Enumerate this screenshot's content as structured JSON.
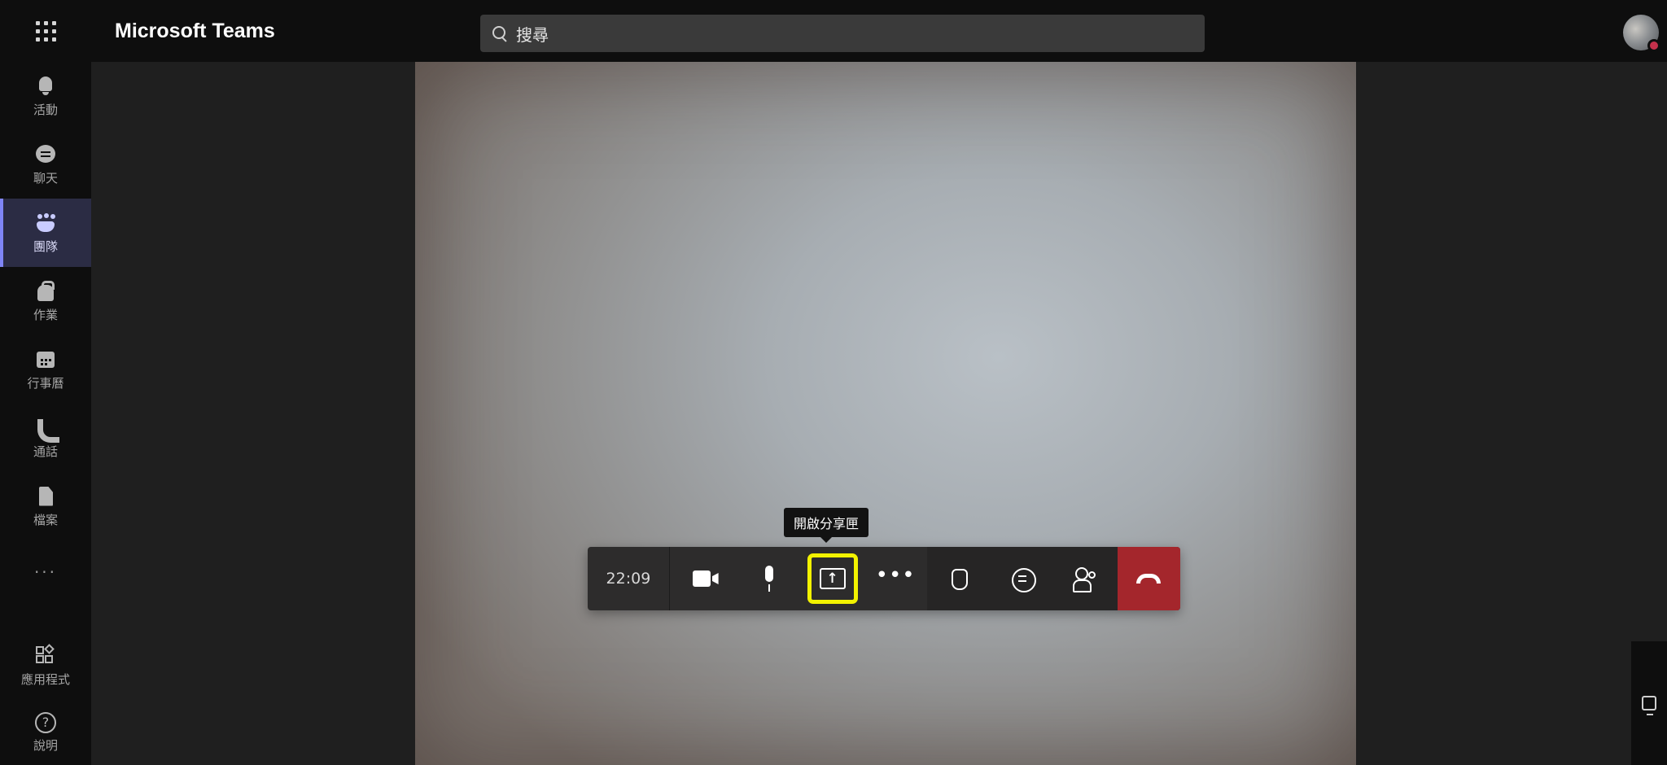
{
  "app": {
    "title": "Microsoft Teams"
  },
  "search": {
    "placeholder": "搜尋"
  },
  "sidebar": {
    "items": [
      {
        "label": "活動",
        "icon": "bell-icon"
      },
      {
        "label": "聊天",
        "icon": "chat-icon"
      },
      {
        "label": "團隊",
        "icon": "teams-icon"
      },
      {
        "label": "作業",
        "icon": "assignments-icon"
      },
      {
        "label": "行事曆",
        "icon": "calendar-icon"
      },
      {
        "label": "通話",
        "icon": "phone-icon"
      },
      {
        "label": "檔案",
        "icon": "file-icon"
      }
    ],
    "more": "...",
    "apps_label": "應用程式",
    "help_label": "說明",
    "active_index": 2
  },
  "call": {
    "timer": "22:09",
    "tooltip": "開啟分享匣",
    "highlight_color": "#f2f200",
    "hangup_color": "#a4262c"
  }
}
